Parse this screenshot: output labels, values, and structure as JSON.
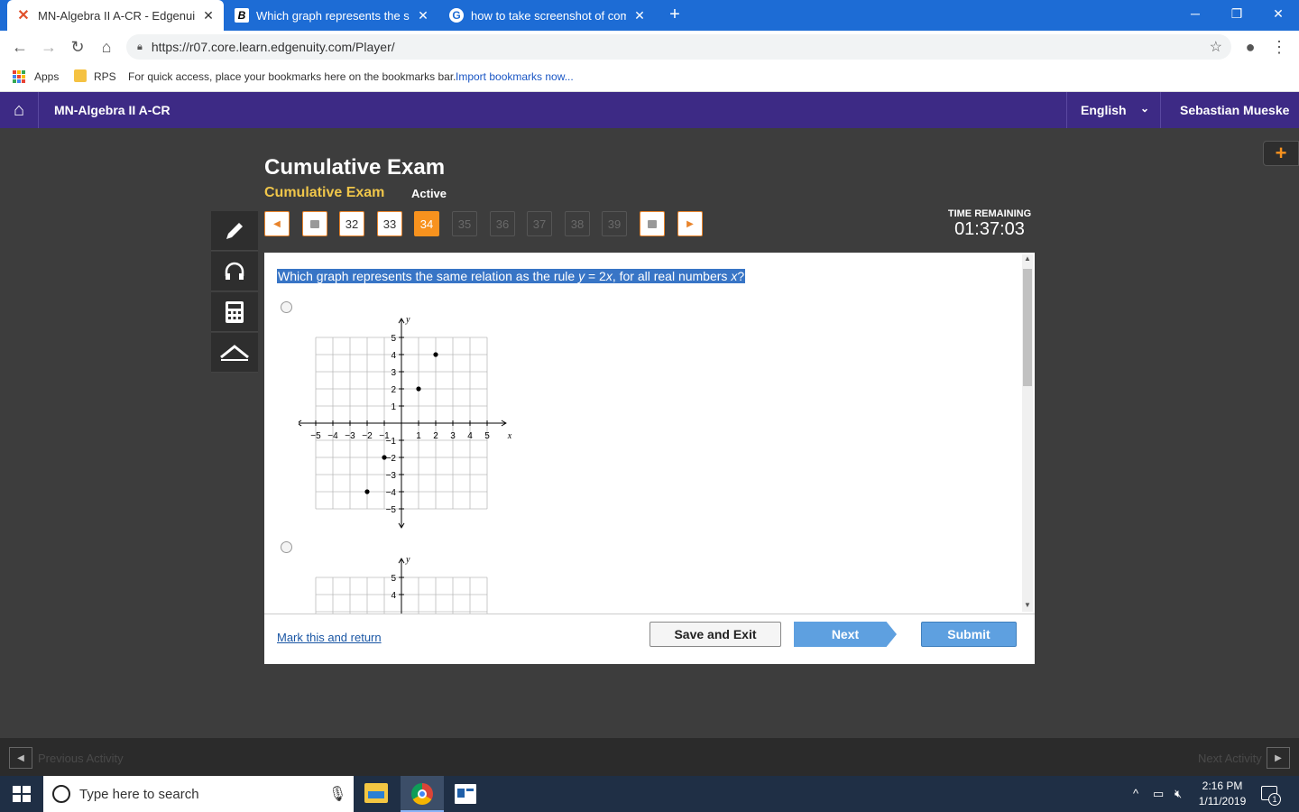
{
  "browser": {
    "tabs": [
      {
        "title": "MN-Algebra II A-CR - Edgenuity",
        "active": true
      },
      {
        "title": "Which graph represents the same",
        "active": false
      },
      {
        "title": "how to take screenshot of comp",
        "active": false
      }
    ],
    "url": "https://r07.core.learn.edgenuity.com/Player/",
    "bookmarks": {
      "apps": "Apps",
      "rps": "RPS",
      "hint": "For quick access, place your bookmarks here on the bookmarks bar.",
      "import_link": "Import bookmarks now..."
    }
  },
  "appbar": {
    "course": "MN-Algebra II A-CR",
    "language": "English",
    "user": "Sebastian Mueske"
  },
  "exam": {
    "title": "Cumulative Exam",
    "subtitle": "Cumulative Exam",
    "status": "Active",
    "time_label": "TIME REMAINING",
    "time_value": "01:37:03",
    "questions": [
      "32",
      "33",
      "34",
      "35",
      "36",
      "37",
      "38",
      "39"
    ],
    "current": "34"
  },
  "question": {
    "text_prefix": "Which graph represents the same relation as the rule ",
    "rule_y": "y",
    "rule_mid": " = 2",
    "rule_x": "x",
    "text_suffix": ", for all real numbers ",
    "var_x": "x",
    "text_end": "?"
  },
  "chart_data": {
    "type": "scatter",
    "x_label": "x",
    "y_label": "y",
    "xlim": [
      -5,
      5
    ],
    "ylim": [
      -5,
      5
    ],
    "grid": true,
    "x_ticks": [
      "−5",
      "−4",
      "−3",
      "−2",
      "−1",
      "1",
      "2",
      "3",
      "4",
      "5"
    ],
    "y_ticks": [
      "5",
      "4",
      "3",
      "2",
      "1",
      "−1",
      "−2",
      "−3",
      "−4",
      "−5"
    ],
    "points": [
      [
        2,
        4
      ],
      [
        1,
        2
      ],
      [
        -1,
        -2
      ],
      [
        -2,
        -4
      ]
    ]
  },
  "chart2_ticks": [
    "5",
    "4"
  ],
  "actions": {
    "mark": "Mark this and return",
    "save": "Save and Exit",
    "next": "Next",
    "submit": "Submit"
  },
  "footer": {
    "prev": "Previous Activity",
    "next": "Next Activity"
  },
  "taskbar": {
    "search": "Type here to search",
    "time": "2:16 PM",
    "date": "1/11/2019",
    "notif": "1"
  }
}
